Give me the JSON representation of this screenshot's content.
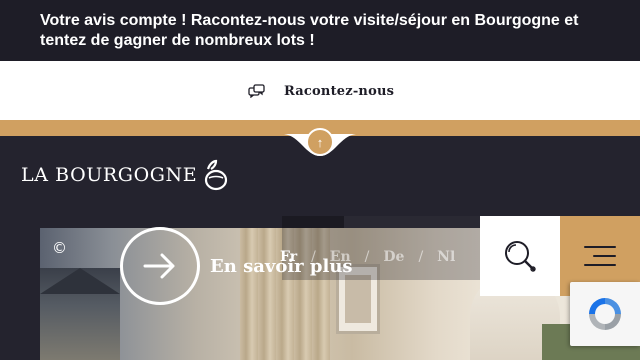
{
  "banner": {
    "text": "Votre avis compte ! Racontez-nous votre visite/séjour en Bourgogne et tentez de gagner de nombreux lots !"
  },
  "cta": {
    "label": "Racontez-nous",
    "icon": "chat-bubbles-icon"
  },
  "scroll_top": {
    "glyph": "↑",
    "icon": "arrow-up-icon"
  },
  "logo": {
    "text": "LA BOURGOGNE",
    "mark_icon": "bourgogne-logo-mark"
  },
  "hero": {
    "copyright_symbol": "©",
    "more_label": "En savoir plus",
    "more_icon": "arrow-right-icon"
  },
  "languages": {
    "items": [
      "Fr",
      "En",
      "De",
      "Nl"
    ],
    "active": "Fr",
    "separator": "/"
  },
  "header_actions": {
    "search_icon": "search-icon",
    "menu_icon": "hamburger-menu-icon"
  },
  "recaptcha": {
    "icon": "recaptcha-icon"
  },
  "colors": {
    "dark_bg": "#24232e",
    "banner_bg": "#1e1d27",
    "gold": "#d0a061",
    "white": "#ffffff"
  }
}
